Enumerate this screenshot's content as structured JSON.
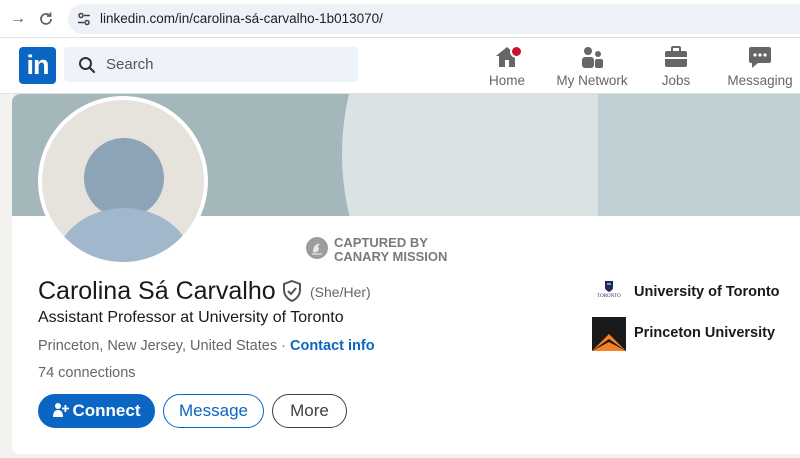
{
  "browser": {
    "url": "linkedin.com/in/carolina-sá-carvalho-1b013070/",
    "back_glyph": "→",
    "reload_glyph": "C"
  },
  "header": {
    "logo_text": "in",
    "search_placeholder": "Search",
    "nav": [
      {
        "label": "Home",
        "icon": "home-icon"
      },
      {
        "label": "My Network",
        "icon": "network-icon"
      },
      {
        "label": "Jobs",
        "icon": "briefcase-icon"
      },
      {
        "label": "Messaging",
        "icon": "messaging-icon"
      }
    ]
  },
  "watermark": {
    "line1": "CAPTURED BY",
    "line2": "CANARY MISSION"
  },
  "profile": {
    "name": "Carolina Sá Carvalho",
    "pronouns": "(She/Her)",
    "headline": "Assistant Professor at University of Toronto",
    "location": "Princeton, New Jersey, United States",
    "separator": " · ",
    "contact_info": "Contact info",
    "connections": "74 connections"
  },
  "actions": {
    "connect": "Connect",
    "message": "Message",
    "more": "More"
  },
  "education": [
    {
      "name": "University of Toronto",
      "logo_text": "TORONTO"
    },
    {
      "name": "Princeton University"
    }
  ],
  "colors": {
    "brand": "#0a66c2",
    "notification": "#cb112d",
    "princeton_orange": "#f58025"
  }
}
